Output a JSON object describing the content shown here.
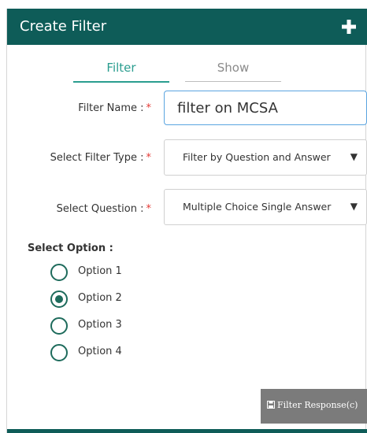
{
  "header": {
    "title": "Create Filter",
    "add_icon": "plus-icon"
  },
  "tabs": [
    {
      "label": "Filter",
      "active": true
    },
    {
      "label": "Show",
      "active": false
    }
  ],
  "form": {
    "filter_name": {
      "label": "Filter Name :",
      "required_mark": "*",
      "value": "filter on MCSA"
    },
    "filter_type": {
      "label": "Select Filter Type :",
      "required_mark": "*",
      "value": "Filter by Question and Answer"
    },
    "question": {
      "label": "Select Question :",
      "required_mark": "*",
      "value": "Multiple Choice Single Answer"
    }
  },
  "options": {
    "title": "Select Option :",
    "items": [
      {
        "label": "Option 1",
        "selected": false
      },
      {
        "label": "Option 2",
        "selected": true
      },
      {
        "label": "Option 3",
        "selected": false
      },
      {
        "label": "Option 4",
        "selected": false
      }
    ]
  },
  "action": {
    "label": "Filter Response(c)",
    "icon": "save-icon"
  },
  "colors": {
    "header_bg": "#0e5c58",
    "accent": "#2a9d8f",
    "radio": "#1e6b5c",
    "button_bg": "#7b7b7b",
    "required": "#e53935"
  }
}
